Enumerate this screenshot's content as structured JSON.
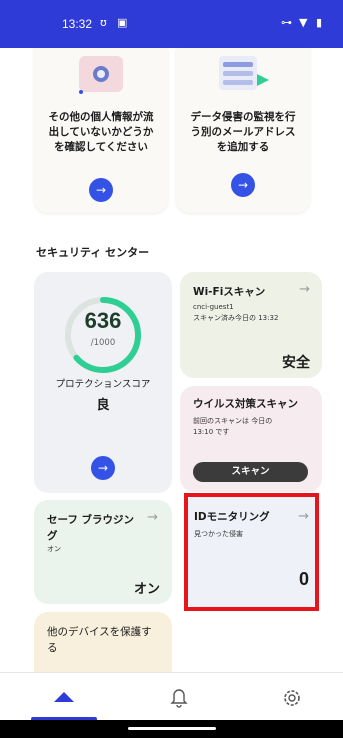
{
  "status_bar": {
    "time": "13:32",
    "icons_left": [
      "notification-icon",
      "calendar-icon"
    ],
    "icons_right": [
      "key-icon",
      "wifi-icon",
      "battery-icon"
    ]
  },
  "top_cards": [
    {
      "text": "その他の個人情報が流出していないかどうかを確認してください"
    },
    {
      "text": "データ侵害の監視を行う別のメールアドレスを追加する"
    }
  ],
  "section_title": "セキュリティ センター",
  "score_card": {
    "score": "636",
    "max": "/1000",
    "label": "プロテクションスコア",
    "grade": "良",
    "score_fraction": 0.636,
    "ring_color": "#2fcf93"
  },
  "wifi_card": {
    "title": "Wi-Fiスキャン",
    "network": "cnci-guest1",
    "subtitle": "スキャン済み今日の 13:32",
    "value": "安全"
  },
  "virus_card": {
    "title": "ウイルス対策スキャン",
    "subtitle": "前回のスキャンは 今日の 13:10 です",
    "button": "スキャン"
  },
  "safe_browsing_card": {
    "title": "セーフ ブラウジング",
    "subtitle": "オン",
    "value": "オン"
  },
  "id_card": {
    "title": "IDモニタリング",
    "subtitle": "見つかった侵害",
    "value": "0"
  },
  "other_devices_card": {
    "title": "他のデバイスを保護する"
  },
  "nav": {
    "items": [
      "home-icon",
      "bell-icon",
      "settings-icon"
    ],
    "active": "home"
  },
  "colors": {
    "primary": "#2f3bd6",
    "accent_blue": "#3552e6",
    "highlight_red": "#e8141b"
  }
}
